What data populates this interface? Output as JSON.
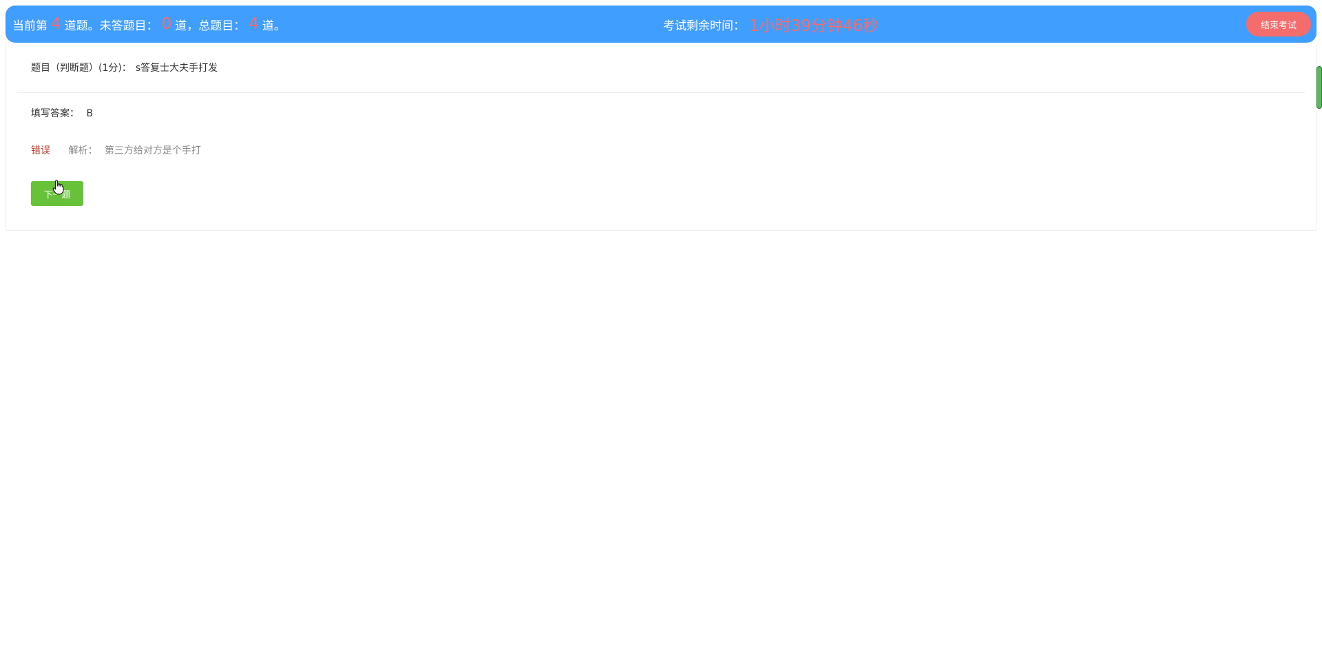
{
  "status_bar": {
    "current_prefix": "当前第",
    "current_number": "4",
    "current_suffix": "道题。未答题目：",
    "unanswered_number": "0",
    "unanswered_suffix": "道，总题目：",
    "total_number": "4",
    "total_suffix": "道。",
    "time_label": "考试剩余时间：",
    "time_value": "1小时39分钟46秒",
    "end_exam_label": "结束考试"
  },
  "question": {
    "label": "题目（判断题）(1分)：",
    "text": "s答复士大夫手打发"
  },
  "answer": {
    "label": "填写答案：",
    "value": "B"
  },
  "result": {
    "status": "错误",
    "analysis_label": "解析：",
    "analysis_text": "第三方给对方是个手打"
  },
  "actions": {
    "next_label": "下一题"
  },
  "colors": {
    "topbar": "#409EFF",
    "highlight": "#F56C6C",
    "next_button": "#67C23A",
    "wrong": "#C0392B"
  }
}
